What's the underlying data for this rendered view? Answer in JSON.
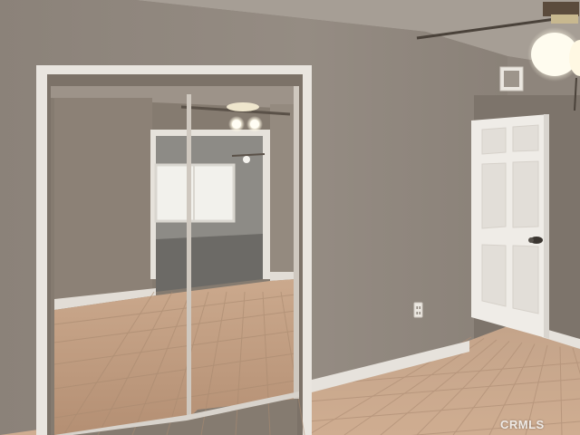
{
  "photo": {
    "watermark": "CRMLS",
    "colors": {
      "wall": "#8d847b",
      "wall_light": "#9b9289",
      "ceiling": "#a9a198",
      "floor_tile": "#c9a98e",
      "floor_grout": "#b49379",
      "trim": "#e8e4de",
      "door": "#efece7",
      "mirror_wall": "#857b70",
      "window_light": "#f2f1ec",
      "carpet": "#6c6a66",
      "light_glow": "#fffdf2"
    },
    "icons": [
      "ceiling-fan-icon",
      "door-knob-icon",
      "outlet-icon",
      "air-vent-icon"
    ]
  }
}
